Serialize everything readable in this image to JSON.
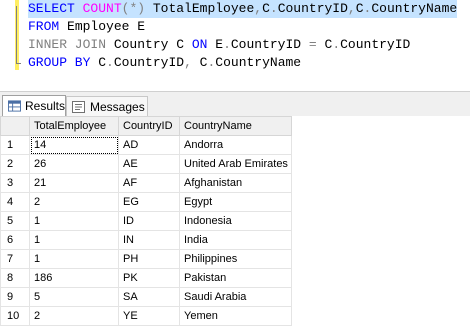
{
  "editor": {
    "lines": [
      {
        "k1": "SELECT",
        "f1": "COUNT",
        "g1": "(*)",
        "t1": " TotalEmployee",
        "g2": ",",
        "t2": "C",
        "g3": ".",
        "t3": "CountryID",
        "g4": ",",
        "t4": "C",
        "g5": ".",
        "t5": "CountryName"
      },
      {
        "k1": "FROM",
        "t1": " Employee E"
      },
      {
        "g1": "INNER JOIN",
        "t1": " Country C ",
        "k1": "ON",
        "t2": " E",
        "g2": ".",
        "t3": "CountryID ",
        "g3": "=",
        "t4": " C",
        "g4": ".",
        "t5": "CountryID"
      },
      {
        "k1": "GROUP BY",
        "t1": " C",
        "g1": ".",
        "t2": "CountryID",
        "g2": ",",
        "t3": " C",
        "g3": ".",
        "t4": "CountryName"
      }
    ]
  },
  "tabs": {
    "results": "Results",
    "messages": "Messages"
  },
  "grid": {
    "columns": [
      "TotalEmployee",
      "CountryID",
      "CountryName"
    ],
    "rows": [
      {
        "n": "1",
        "total": "14",
        "id": "AD",
        "name": "Andorra"
      },
      {
        "n": "2",
        "total": "26",
        "id": "AE",
        "name": "United Arab Emirates"
      },
      {
        "n": "3",
        "total": "21",
        "id": "AF",
        "name": "Afghanistan"
      },
      {
        "n": "4",
        "total": "2",
        "id": "EG",
        "name": "Egypt"
      },
      {
        "n": "5",
        "total": "1",
        "id": "ID",
        "name": "Indonesia"
      },
      {
        "n": "6",
        "total": "1",
        "id": "IN",
        "name": "India"
      },
      {
        "n": "7",
        "total": "1",
        "id": "PH",
        "name": "Philippines"
      },
      {
        "n": "8",
        "total": "186",
        "id": "PK",
        "name": "Pakistan"
      },
      {
        "n": "9",
        "total": "5",
        "id": "SA",
        "name": "Saudi Arabia"
      },
      {
        "n": "10",
        "total": "2",
        "id": "YE",
        "name": "Yemen"
      }
    ]
  },
  "colors": {
    "keyword": "#0000ff",
    "function": "#ff00ff",
    "operator": "#808080",
    "change_bar": "#ffee62"
  }
}
